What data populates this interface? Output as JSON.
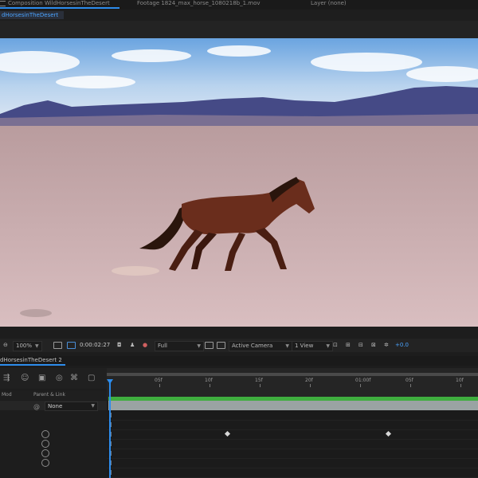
{
  "tabs": {
    "composition": "Composition WildHorsesinTheDesert",
    "footage": "Footage 1824_max_horse_1080218b_1.mov",
    "layer": "Layer (none)"
  },
  "comp_subtab": "dHorsesinTheDesert",
  "viewer": {
    "magnification": "100%",
    "timecode": "0:00:02:27",
    "resolution": "Full",
    "camera": "Active Camera",
    "views": "1 View",
    "exposure": "+0.0"
  },
  "timeline": {
    "tab_label": "dHorsesinTheDesert 2",
    "columns": {
      "source": "Mod",
      "parent": "Parent & Link"
    },
    "layer_parent": "None",
    "ruler_labels": [
      "05f",
      "10f",
      "15f",
      "20f",
      "01:00f",
      "05f",
      "10f"
    ],
    "keyframes_frames": [
      12,
      28
    ]
  },
  "colors": {
    "accent": "#2d8ceb",
    "label_green": "#3fae3f",
    "layer_bar": "#9aa3a3"
  }
}
